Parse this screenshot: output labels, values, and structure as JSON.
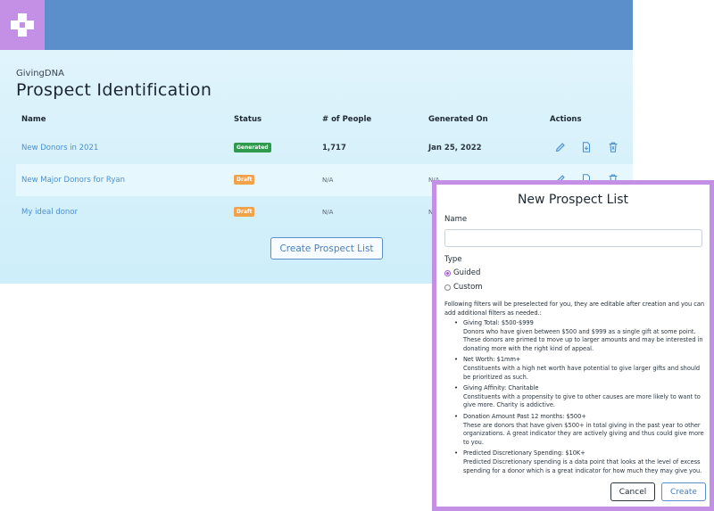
{
  "app": {
    "brand": "GivingDNA",
    "page_title": "Prospect Identification",
    "logo_icon": "plus-cross-logo",
    "accent_color": "#5b8fcb",
    "brand_color": "#c390e6"
  },
  "table": {
    "headers": [
      "Name",
      "Status",
      "# of People",
      "Generated On",
      "Actions"
    ],
    "rows": [
      {
        "name": "New Donors in 2021",
        "status": "Generated",
        "people": "1,717",
        "generated_on": "Jan 25, 2022"
      },
      {
        "name": "New Major Donors for Ryan",
        "status": "Draft",
        "people": "N/A",
        "generated_on": "N/A"
      },
      {
        "name": "My ideal donor",
        "status": "Draft",
        "people": "N/A",
        "generated_on": "N/A"
      }
    ],
    "action_icons": [
      "pencil-icon",
      "download-file-icon",
      "trash-icon"
    ]
  },
  "create_list_label": "Create Prospect List",
  "modal": {
    "title": "New Prospect List",
    "name_label": "Name",
    "name_value": "",
    "type_label": "Type",
    "type_options": [
      {
        "label": "Guided",
        "selected": true
      },
      {
        "label": "Custom",
        "selected": false
      }
    ],
    "intro": "Following filters will be preselected for you, they are editable after creation and you can add additional filters as needed.:",
    "filters": [
      {
        "title": "Giving Total: $500-$999",
        "desc": "Donors who have given between $500 and $999 as a single gift at some point. These donors are primed to move up to larger amounts and may be interested in donating more with the right kind of appeal."
      },
      {
        "title": "Net Worth: $1mm+",
        "desc": "Constituents with a high net worth have potential to give larger gifts and should be prioritized as such."
      },
      {
        "title": "Giving Affinity: Charitable",
        "desc": "Constituents with a propensity to give to other causes are more likely to want to give more. Charity is addictive."
      },
      {
        "title": "Donation Amount Past 12 months: $500+",
        "desc": "These are donors that have given $500+ in total giving in the past year to other organizations. A great indicator they are actively giving and thus could give more to you."
      },
      {
        "title": "Predicted Discretionary Spending: $10K+",
        "desc": "Predicted Discretionary spending is a data point that looks at the level of excess spending for a donor which is a great indicator for how much they may give you."
      }
    ],
    "cancel_label": "Cancel",
    "create_label": "Create"
  }
}
